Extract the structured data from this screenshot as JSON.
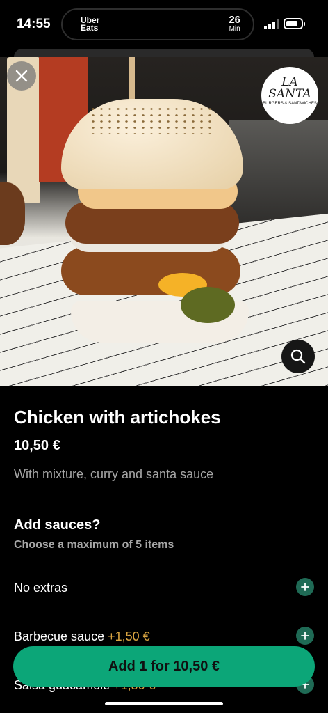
{
  "status_bar": {
    "time": "14:55",
    "live_activity": {
      "app": "Uber Eats",
      "eta_value": "26",
      "eta_unit": "Min"
    },
    "signal_icon": "cellular-signal-icon",
    "battery_icon": "battery-icon"
  },
  "hero": {
    "image": "burger-photo",
    "close_icon": "close-icon",
    "search_icon": "search-icon",
    "restaurant_logo": {
      "line1": "LA",
      "line2": "SANTA",
      "tagline": "BURGERS & SANDWICHES"
    }
  },
  "item": {
    "title": "Chicken with artichokes",
    "price": "10,50 €",
    "description": "With mixture, curry and santa sauce"
  },
  "sauces": {
    "title": "Add sauces?",
    "subtitle": "Choose a maximum of 5 items",
    "options": [
      {
        "label": "No extras",
        "price": ""
      },
      {
        "label": "Barbecue sauce",
        "price": "+1,50 €"
      },
      {
        "label": "Salsa guacamole",
        "price": "+1,50 €"
      }
    ]
  },
  "cta": {
    "label": "Add 1 for 10,50 €"
  },
  "colors": {
    "accent": "#0ca678",
    "price_highlight": "#d9a441",
    "plus_button": "#1f6a55"
  }
}
